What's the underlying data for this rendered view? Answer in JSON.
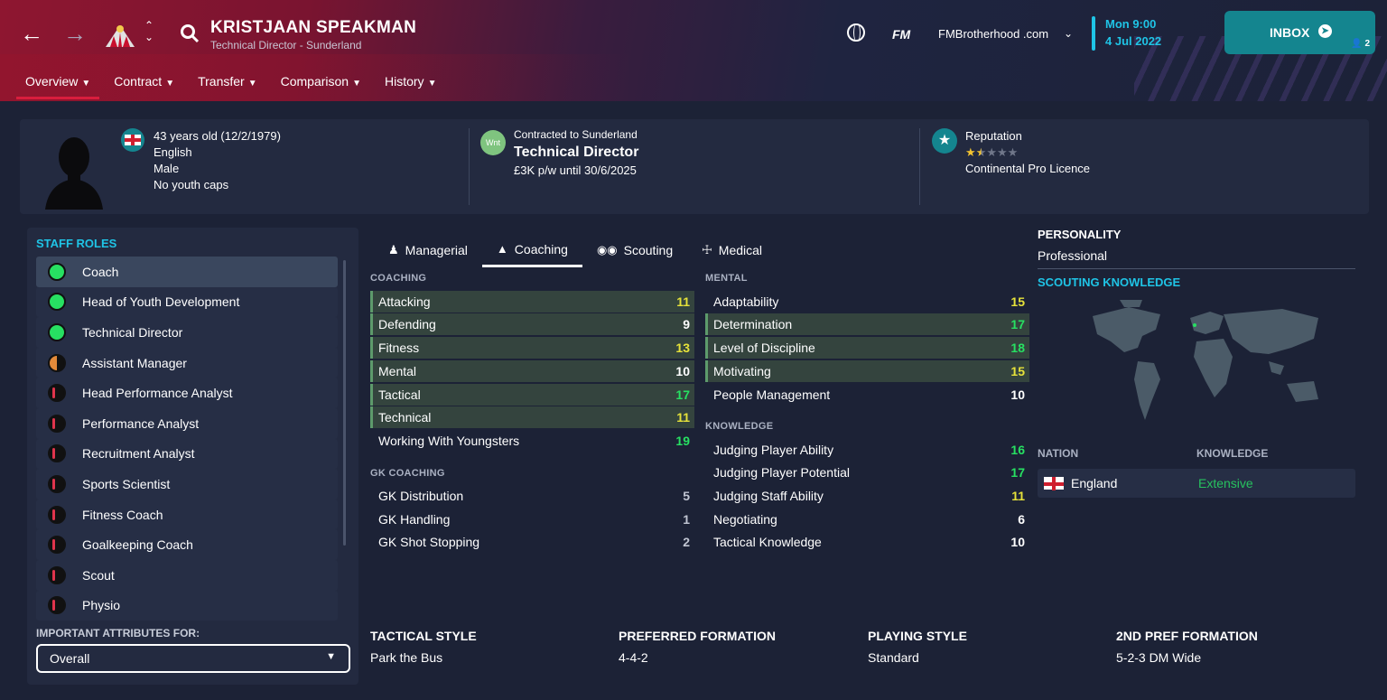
{
  "header": {
    "name": "KRISTJAAN SPEAKMAN",
    "subtitle": "Technical Director - Sunderland",
    "nav_tabs": [
      "Overview",
      "Contract",
      "Transfer",
      "Comparison",
      "History"
    ],
    "logo": "FM",
    "site": "FMBrotherhood .com",
    "day": "Mon 9:00",
    "date": "4 Jul 2022",
    "inbox_label": "INBOX",
    "inbox_count": "2"
  },
  "profile": {
    "age": "43 years old (12/2/1979)",
    "nationality": "English",
    "gender": "Male",
    "caps": "No youth caps",
    "badge": "Wnt",
    "contract_label": "Contracted to Sunderland",
    "role": "Technical Director",
    "wage": "£3K p/w until 30/6/2025",
    "reputation_label": "Reputation",
    "reputation_stars": 1.5,
    "licence": "Continental Pro Licence"
  },
  "staff_roles": {
    "title": "STAFF ROLES",
    "items": [
      {
        "label": "Coach",
        "suitability": "full"
      },
      {
        "label": "Head of Youth Development",
        "suitability": "full"
      },
      {
        "label": "Technical Director",
        "suitability": "full"
      },
      {
        "label": "Assistant Manager",
        "suitability": "half"
      },
      {
        "label": "Head Performance Analyst",
        "suitability": "low"
      },
      {
        "label": "Performance Analyst",
        "suitability": "low"
      },
      {
        "label": "Recruitment Analyst",
        "suitability": "low"
      },
      {
        "label": "Sports Scientist",
        "suitability": "low"
      },
      {
        "label": "Fitness Coach",
        "suitability": "low"
      },
      {
        "label": "Goalkeeping Coach",
        "suitability": "low"
      },
      {
        "label": "Scout",
        "suitability": "low"
      },
      {
        "label": "Physio",
        "suitability": "low"
      }
    ],
    "important_label": "IMPORTANT ATTRIBUTES FOR:",
    "important_value": "Overall"
  },
  "attr_tabs": [
    "Managerial",
    "Coaching",
    "Scouting",
    "Medical"
  ],
  "coaching": {
    "title": "COACHING",
    "items": [
      {
        "label": "Attacking",
        "value": "11"
      },
      {
        "label": "Defending",
        "value": "9"
      },
      {
        "label": "Fitness",
        "value": "13"
      },
      {
        "label": "Mental",
        "value": "10"
      },
      {
        "label": "Tactical",
        "value": "17"
      },
      {
        "label": "Technical",
        "value": "11"
      },
      {
        "label": "Working With Youngsters",
        "value": "19"
      }
    ]
  },
  "gk_coaching": {
    "title": "GK COACHING",
    "items": [
      {
        "label": "GK Distribution",
        "value": "5"
      },
      {
        "label": "GK Handling",
        "value": "1"
      },
      {
        "label": "GK Shot Stopping",
        "value": "2"
      }
    ]
  },
  "mental": {
    "title": "MENTAL",
    "items": [
      {
        "label": "Adaptability",
        "value": "15"
      },
      {
        "label": "Determination",
        "value": "17"
      },
      {
        "label": "Level of Discipline",
        "value": "18"
      },
      {
        "label": "Motivating",
        "value": "15"
      },
      {
        "label": "People Management",
        "value": "10"
      }
    ]
  },
  "knowledge": {
    "title": "KNOWLEDGE",
    "items": [
      {
        "label": "Judging Player Ability",
        "value": "16"
      },
      {
        "label": "Judging Player Potential",
        "value": "17"
      },
      {
        "label": "Judging Staff Ability",
        "value": "11"
      },
      {
        "label": "Negotiating",
        "value": "6"
      },
      {
        "label": "Tactical Knowledge",
        "value": "10"
      }
    ]
  },
  "side": {
    "personality_label": "PERSONALITY",
    "personality": "Professional",
    "scouting_label": "SCOUTING KNOWLEDGE",
    "nation_col": "NATION",
    "knowledge_col": "KNOWLEDGE",
    "nation": "England",
    "nation_knowledge": "Extensive"
  },
  "tactics": {
    "tactical_style_label": "TACTICAL STYLE",
    "tactical_style": "Park the Bus",
    "pref_formation_label": "PREFERRED FORMATION",
    "pref_formation": "4-4-2",
    "playing_style_label": "PLAYING STYLE",
    "playing_style": "Standard",
    "second_formation_label": "2ND PREF FORMATION",
    "second_formation": "5-2-3 DM Wide"
  },
  "colors": {
    "accent": "#1fc4e6",
    "inbox": "#14858f",
    "good": "#27e062",
    "ok": "#e6e23a"
  }
}
